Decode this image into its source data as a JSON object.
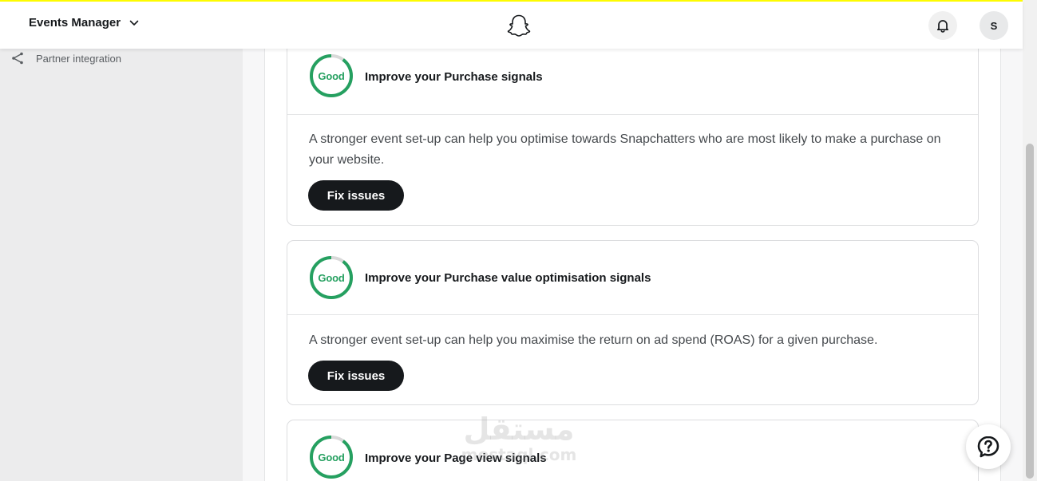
{
  "header": {
    "app_title": "Events Manager",
    "avatar_initial": "S"
  },
  "sidebar": {
    "items": [
      {
        "label": "Partner integration",
        "icon": "share-icon"
      }
    ]
  },
  "cards": [
    {
      "score": "Good",
      "score_fraction": 0.9,
      "title": "Improve your Purchase signals",
      "description": "A stronger event set-up can help you optimise towards Snapchatters who are most likely to make a purchase on your website.",
      "button": "Fix issues"
    },
    {
      "score": "Good",
      "score_fraction": 0.9,
      "title": "Improve your Purchase value optimisation signals",
      "description": "A stronger event set-up can help you maximise the return on ad spend (ROAS) for a given purchase.",
      "button": "Fix issues"
    },
    {
      "score": "Good",
      "score_fraction": 0.9,
      "title": "Improve your Page view signals"
    }
  ],
  "watermark": {
    "arabic": "مستقل",
    "latin": "mostaql.com"
  },
  "colors": {
    "accent_yellow": "#fffc00",
    "good_green": "#25a060",
    "ring_track": "#d9d9d9",
    "button_bg": "#16191c"
  }
}
